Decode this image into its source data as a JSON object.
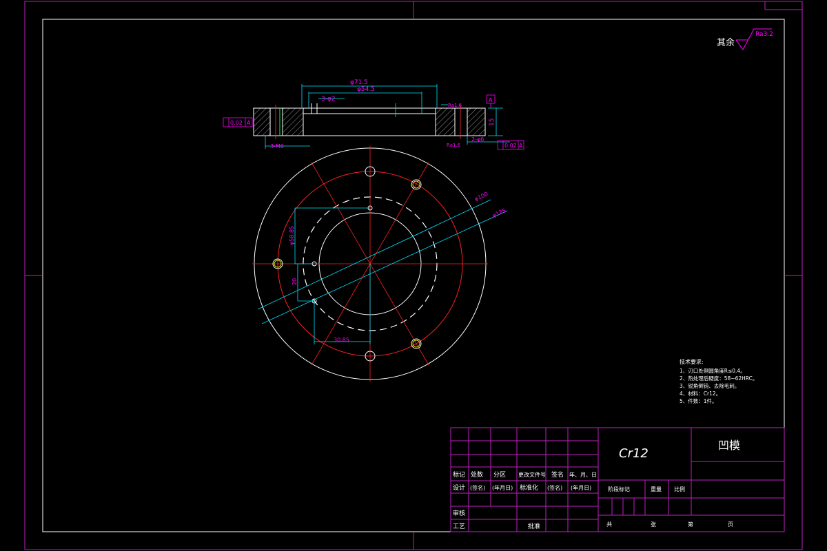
{
  "surface_finish": {
    "prefix": "其余",
    "value": "Ra3.2"
  },
  "dimensions": {
    "outer_dia": "φ71.5",
    "recess_dia": "φ54.5",
    "recess_depth": "3-φ2",
    "height": "15",
    "flatness_top": "0.02",
    "flatness_top_datum": "A",
    "parallel_bottom": "0.02",
    "parallel_bottom_datum": "A",
    "thread": "3-M6",
    "holes": "2-φ6",
    "ra_top": "Ra1.6",
    "ra_bottom": "Ra1.6",
    "datum_label": "A",
    "pcd_large": "φ100",
    "pcd_small": "φ125",
    "vertical_dim_1": "φ58.85",
    "vertical_dim_2": "20",
    "horizontal_dim": "30.85"
  },
  "tech_requirements": {
    "title": "技术要求:",
    "items": [
      "1、刃口处倒圆角度R≤0.4。",
      "2、热处理后硬度：58~62HRC。",
      "3、锐角倒钝、去除毛刺。",
      "4、材料：Cr12。",
      "5、件数：1件。"
    ]
  },
  "title_block": {
    "material": "Cr12",
    "part_name": "凹模",
    "headers": [
      "标记",
      "处数",
      "分区",
      "更改文件号",
      "签名",
      "年、月、日"
    ],
    "row_design": [
      "设计",
      "(签名)",
      "(年月日)",
      "标准化",
      "(签名)",
      "(年月日)"
    ],
    "row_review": "审核",
    "row_process": "工艺",
    "approve": "批准",
    "stage_label": "阶段标记",
    "weight_label": "重量",
    "scale_label": "比例",
    "total_label": "共",
    "sheet_label": "张",
    "page_label": "第",
    "page_suffix": "页"
  }
}
